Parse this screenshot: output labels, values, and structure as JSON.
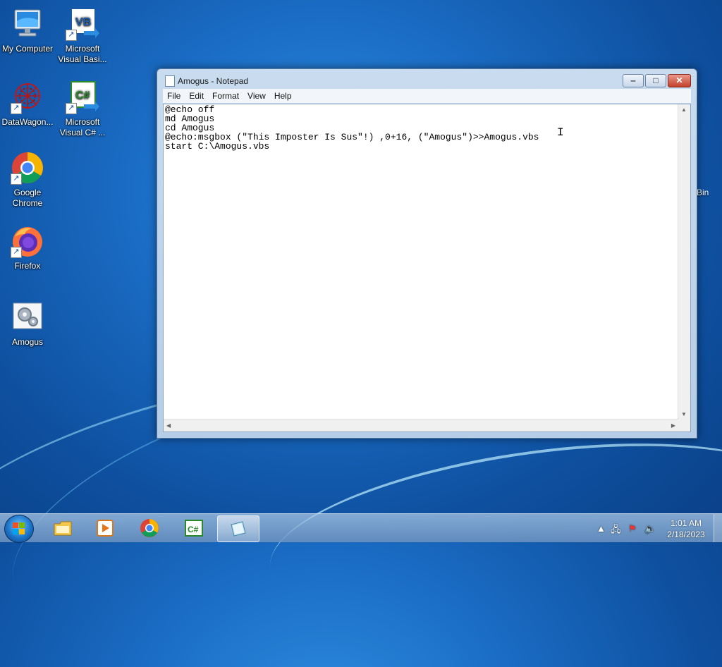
{
  "desktop": {
    "icons": [
      {
        "label": "My Computer"
      },
      {
        "label": "Microsoft Visual Basi..."
      },
      {
        "label": "DataWagon..."
      },
      {
        "label": "Microsoft Visual C# ..."
      },
      {
        "label": "Google Chrome"
      },
      {
        "label": "Firefox"
      },
      {
        "label": "Amogus"
      }
    ],
    "recycle_bin_label": "Bin"
  },
  "notepad": {
    "title": "Amogus - Notepad",
    "menu": [
      "File",
      "Edit",
      "Format",
      "View",
      "Help"
    ],
    "content": "@echo off\nmd Amogus\ncd Amogus\n@echo:msgbox (\"This Imposter Is Sus\"!) ,0+16, (\"Amogus\")>>Amogus.vbs\nstart C:\\Amogus.vbs",
    "window_buttons": {
      "minimize": "‒",
      "maximize": "□",
      "close": "✕"
    }
  },
  "taskbar": {
    "apps": [
      "windows-explorer",
      "media-player",
      "google-chrome",
      "visual-csharp",
      "notepad"
    ],
    "active_app": "notepad",
    "clock": {
      "time": "1:01 AM",
      "date": "2/18/2023"
    }
  },
  "colors": {
    "accent": "#1a6cc4",
    "close_button": "#c3402a"
  }
}
